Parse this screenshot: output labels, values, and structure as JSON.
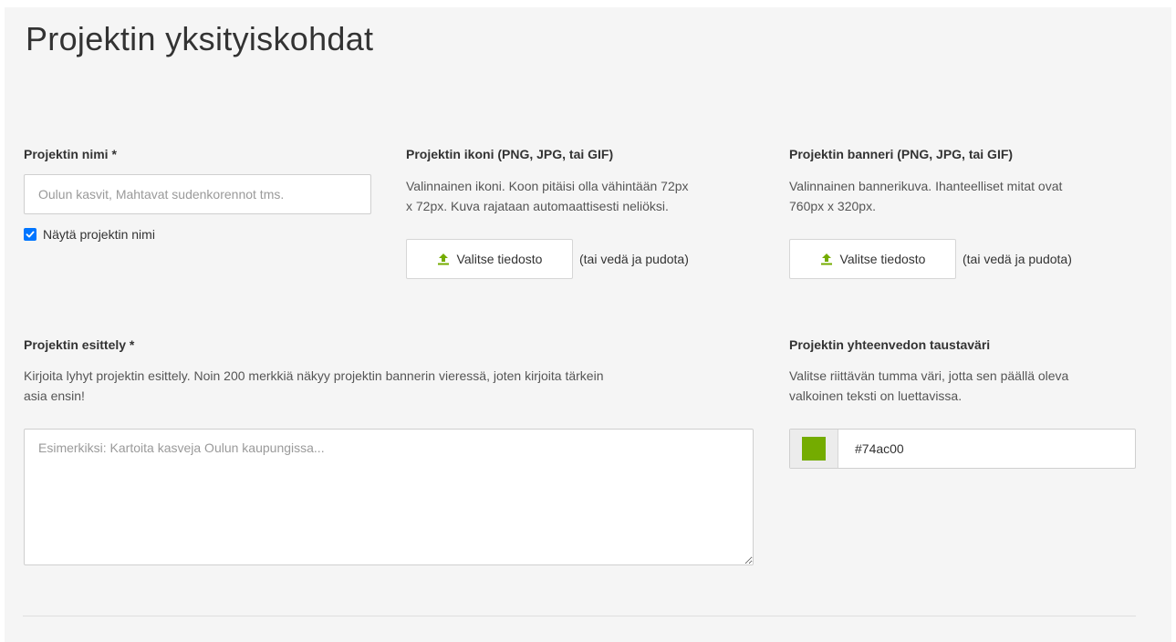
{
  "page": {
    "title": "Projektin yksityiskohdat"
  },
  "name": {
    "label": "Projektin nimi *",
    "placeholder": "Oulun kasvit, Mahtavat sudenkorennot tms.",
    "value": "",
    "show_name_label": "Näytä projektin nimi",
    "show_name_checked": true
  },
  "icon": {
    "label": "Projektin ikoni (PNG, JPG, tai GIF)",
    "help_line1": "Valinnainen ikoni. Koon pitäisi olla vähintään 72px",
    "help_line2": "x 72px. Kuva rajataan automaattisesti neliöksi.",
    "button_label": "Valitse tiedosto",
    "drop_hint": "(tai vedä ja pudota)"
  },
  "banner": {
    "label": "Projektin banneri (PNG, JPG, tai GIF)",
    "help_line1": "Valinnainen bannerikuva. Ihanteelliset mitat ovat",
    "help_line2": "760px x 320px.",
    "button_label": "Valitse tiedosto",
    "drop_hint": "(tai vedä ja pudota)"
  },
  "description": {
    "label": "Projektin esittely *",
    "help_line1": "Kirjoita lyhyt projektin esittely. Noin 200 merkkiä näkyy projektin bannerin vieressä, joten kirjoita tärkein",
    "help_line2": "asia ensin!",
    "placeholder": "Esimerkiksi: Kartoita kasveja Oulun kaupungissa...",
    "value": ""
  },
  "color": {
    "label": "Projektin yhteenvedon taustaväri",
    "help_line1": "Valitse riittävän tumma väri, jotta sen päällä oleva",
    "help_line2": "valkoinen teksti on luettavissa.",
    "value": "#74ac00"
  },
  "colors": {
    "accent_green": "#74ac00",
    "checkbox_blue": "#0075ff",
    "upload_icon": "#74ac00"
  },
  "icons": {
    "upload": "upload-arrow-icon",
    "check": "checkmark-icon",
    "resize": "resize-grip-icon"
  }
}
